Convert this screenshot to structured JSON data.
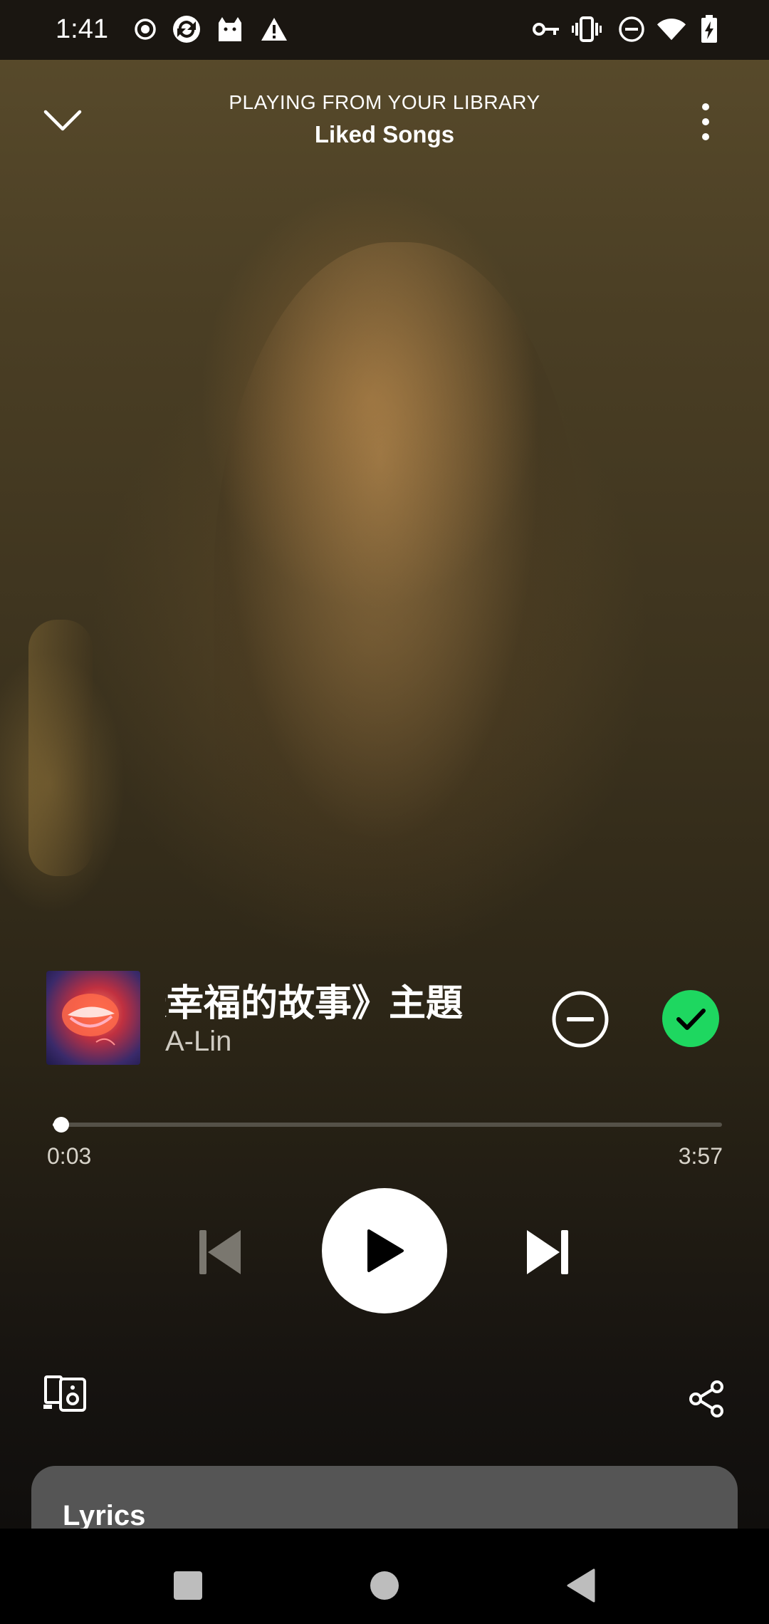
{
  "status_bar": {
    "time": "1:41",
    "left_icons": [
      "record-icon",
      "sync-app-icon",
      "cat-app-icon",
      "warning-icon"
    ],
    "right_icons": [
      "vpn-key-icon",
      "vibrate-icon",
      "do-not-disturb-icon",
      "wifi-icon",
      "battery-charging-icon"
    ]
  },
  "header": {
    "context_label": "PLAYING FROM YOUR LIBRARY",
    "context_title": "Liked Songs"
  },
  "track": {
    "title": "《最幸福的故事》主題曲",
    "artist": "A-Lin",
    "liked": true
  },
  "playback": {
    "elapsed": "0:03",
    "duration": "3:57",
    "progress_fraction": 0.013,
    "is_playing": false
  },
  "lyrics": {
    "title": "Lyrics"
  },
  "colors": {
    "liked_green": "#1ed760",
    "lyrics_card": "#555555",
    "accent_white": "#ffffff"
  }
}
